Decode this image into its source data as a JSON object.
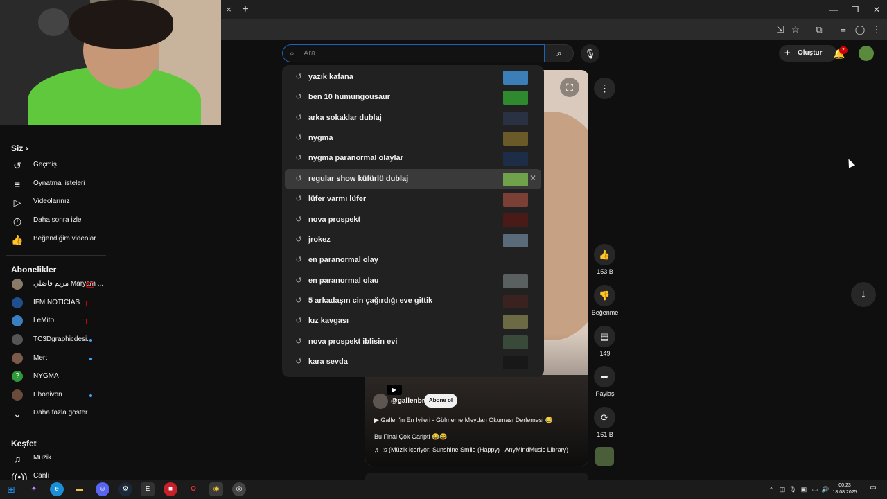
{
  "browser": {
    "tab_close": "×",
    "new_tab": "+",
    "window_controls": [
      "—",
      "❐",
      "✕"
    ]
  },
  "search": {
    "placeholder": "Ara",
    "value": "",
    "suggestions": [
      {
        "text": "yazık kafana",
        "thumb": "#3c7fb8"
      },
      {
        "text": "ben 10 humungousaur",
        "thumb": "#2f8a2f"
      },
      {
        "text": "arka sokaklar dublaj",
        "thumb": "#2a3142"
      },
      {
        "text": "nygma",
        "thumb": "#6a5a2a"
      },
      {
        "text": "nygma paranormal olaylar",
        "thumb": "#1d2d48"
      },
      {
        "text": "regular show küfürlü dublaj",
        "thumb": "#6fa24a"
      },
      {
        "text": "lüfer varmı lüfer",
        "thumb": "#7a4035"
      },
      {
        "text": "nova prospekt",
        "thumb": "#4a1a18"
      },
      {
        "text": "jrokez",
        "thumb": "#5a6a78"
      },
      {
        "text": "en paranormal olay",
        "thumb": ""
      },
      {
        "text": "en paranormal olau",
        "thumb": "#5a5f60"
      },
      {
        "text": "5 arkadaşın cin çağırdığı eve gittik",
        "thumb": "#3a2220"
      },
      {
        "text": "kız kavgası",
        "thumb": "#6b6a45"
      },
      {
        "text": "nova prospekt iblisin evi",
        "thumb": "#3a4a3a"
      },
      {
        "text": "kara sevda",
        "thumb": "#181818"
      }
    ]
  },
  "header": {
    "create_label": "Oluştur",
    "notif_count": "2"
  },
  "sidebar": {
    "you_title": "Siz",
    "you_items": [
      {
        "label": "Geçmiş",
        "icon": "history-icon"
      },
      {
        "label": "Oynatma listeleri",
        "icon": "playlist-icon"
      },
      {
        "label": "Videolarınız",
        "icon": "your-videos-icon"
      },
      {
        "label": "Daha sonra izle",
        "icon": "watch-later-icon"
      },
      {
        "label": "Beğendiğim videolar",
        "icon": "liked-icon"
      }
    ],
    "subs_title": "Abonelikler",
    "subs": [
      {
        "label": "مريم فاضلي Maryam ...",
        "color": "#8a7a6a",
        "status": "live"
      },
      {
        "label": "IFM NOTICIAS",
        "color": "#1f4f8f",
        "status": "live"
      },
      {
        "label": "LeMito",
        "color": "#3a7fc0",
        "status": "live"
      },
      {
        "label": "TC3Dgraphicdesi...",
        "color": "#555555",
        "status": "new"
      },
      {
        "label": "Mert",
        "color": "#7a5a4a",
        "status": "new"
      },
      {
        "label": "NYGMA",
        "color": "#2e9a3a",
        "status": ""
      },
      {
        "label": "Ebonivon",
        "color": "#6a4a3a",
        "status": "new"
      }
    ],
    "show_more": "Daha fazla göster",
    "explore_title": "Keşfet",
    "explore_items": [
      {
        "label": "Müzik",
        "icon": "music-icon"
      },
      {
        "label": "Canlı",
        "icon": "live-icon"
      }
    ]
  },
  "short": {
    "channel": "@gallenbr",
    "subscribe": "Abone ol",
    "playlist_line": "Gallen'in En İyileri - Gülmeme Meydan Okuması Derlemesi 😂",
    "title": "Bu Final Çok Garipti 😂😂",
    "music": "♬ :s (Müzik içeriyor: Sunshine Smile (Happy) · AnyMindMusic Library)",
    "likes": "153 B",
    "dislike_label": "Beğenme",
    "comments": "149",
    "share_label": "Paylaş",
    "remix": "161 B"
  },
  "taskbar": {
    "time": "00:23",
    "date": "18.08.2025",
    "apps": [
      {
        "icon": "start-icon",
        "glyph": "⊞",
        "color": "#1f8ff0"
      },
      {
        "icon": "copilot-icon",
        "glyph": "✦",
        "color": "#8a5ae0"
      },
      {
        "icon": "edge-icon",
        "glyph": "e",
        "color": "#1a8fd8"
      },
      {
        "icon": "explorer-icon",
        "glyph": "▬",
        "color": "#f0c040"
      },
      {
        "icon": "discord-icon",
        "glyph": "☺",
        "color": "#5865f2"
      },
      {
        "icon": "steam-icon",
        "glyph": "⚙",
        "color": "#1b2838"
      },
      {
        "icon": "epic-icon",
        "glyph": "E",
        "color": "#333333"
      },
      {
        "icon": "app-red-icon",
        "glyph": "■",
        "color": "#c8202a"
      },
      {
        "icon": "opera-icon",
        "glyph": "O",
        "color": "#d0202a"
      },
      {
        "icon": "chrome-icon",
        "glyph": "◉",
        "color": "#2a8a3a"
      },
      {
        "icon": "obs-icon",
        "glyph": "◎",
        "color": "#444444"
      }
    ]
  }
}
